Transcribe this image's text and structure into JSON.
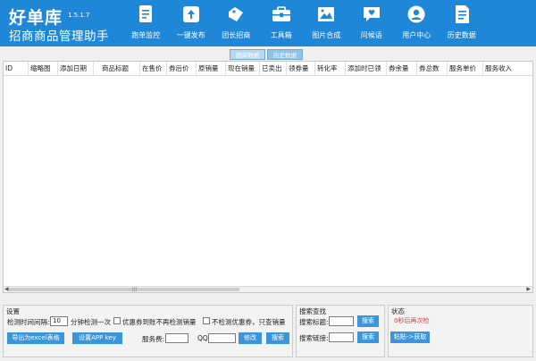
{
  "brand": {
    "name": "好单库",
    "version": "1.5.1.7",
    "subtitle": "招商商品管理助手"
  },
  "nav": [
    {
      "label": "跑单监控",
      "icon": "document-clipboard-icon"
    },
    {
      "label": "一键发布",
      "icon": "upload-publish-icon"
    },
    {
      "label": "团长招商",
      "icon": "tag-coupon-icon"
    },
    {
      "label": "工具箱",
      "icon": "toolbox-icon"
    },
    {
      "label": "图片合成",
      "icon": "image-icon"
    },
    {
      "label": "问候语",
      "icon": "chat-heart-icon"
    },
    {
      "label": "用户中心",
      "icon": "user-icon"
    },
    {
      "label": "历史数据",
      "icon": "history-document-icon"
    }
  ],
  "tabs": [
    {
      "label": "跑单数据"
    },
    {
      "label": "历史数据"
    }
  ],
  "table": {
    "columns": [
      "ID",
      "缩略图",
      "添加日期",
      "商品标题",
      "在售价",
      "券后价",
      "原销量",
      "现在销量",
      "已卖出",
      "领券量",
      "转化率",
      "添加时已领",
      "券余量",
      "券总数",
      "服务单价",
      "服务收入"
    ]
  },
  "settings": {
    "title": "设置",
    "interval_label": "检测时间间隔:",
    "interval_value": "10",
    "interval_unit": "分钟检测一次",
    "stop_when_coupon_done": "优惠券到账不再检测销量",
    "no_coupon_check": "不检测优惠券，只查销量",
    "export_button": "导出为excel表格",
    "set_app_key_button": "设置APP key",
    "service_fee_label": "服务费:",
    "service_fee_value": "",
    "qq_label": "QQ:",
    "qq_value": "",
    "modify_button": "修改",
    "search_button": "搜索"
  },
  "search": {
    "title": "搜索查找",
    "title_label": "搜索标题:",
    "title_value": "",
    "link_label": "搜索链接:",
    "link_value": "",
    "search_title_button": "搜索",
    "search_link_button": "搜索"
  },
  "status": {
    "title": "状态",
    "message": "0秒后再次检",
    "paste_button": "粘贴->获取"
  }
}
